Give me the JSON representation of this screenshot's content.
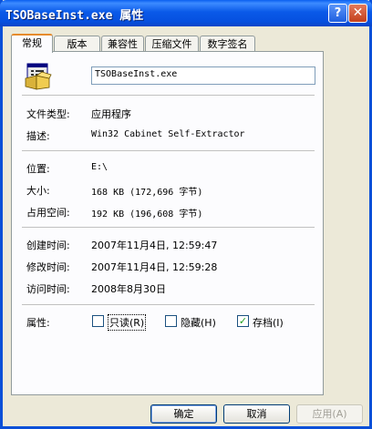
{
  "window": {
    "title": "TSOBaseInst.exe 属性",
    "help_glyph": "?",
    "close_glyph": "✕"
  },
  "tabs": [
    {
      "label": "常规",
      "active": true
    },
    {
      "label": "版本",
      "active": false
    },
    {
      "label": "兼容性",
      "active": false
    },
    {
      "label": "压缩文件",
      "active": false
    },
    {
      "label": "数字签名",
      "active": false
    }
  ],
  "general": {
    "file_name": "TSOBaseInst.exe",
    "icon": "installer-package-icon",
    "fields": {
      "type": {
        "label": "文件类型:",
        "value": "应用程序"
      },
      "description": {
        "label": "描述:",
        "value": "Win32 Cabinet Self-Extractor"
      },
      "location": {
        "label": "位置:",
        "value": "E:\\"
      },
      "size": {
        "label": "大小:",
        "value": "168 KB (172,696 字节)"
      },
      "size_on_disk": {
        "label": "占用空间:",
        "value": "192 KB (196,608 字节)"
      },
      "created": {
        "label": "创建时间:",
        "value": "2007年11月4日, 12:59:47"
      },
      "modified": {
        "label": "修改时间:",
        "value": "2007年11月4日, 12:59:28"
      },
      "accessed": {
        "label": "访问时间:",
        "value": "2008年8月30日"
      }
    },
    "attributes": {
      "label": "属性:",
      "read_only": {
        "label": "只读(R)",
        "checked": false
      },
      "hidden": {
        "label": "隐藏(H)",
        "checked": false
      },
      "archive": {
        "label": "存档(I)",
        "checked": true
      }
    }
  },
  "buttons": {
    "ok": "确定",
    "cancel": "取消",
    "apply": "应用(A)"
  },
  "colors": {
    "titlebar": "#0A5AE8",
    "dialog_bg": "#ECE9D8",
    "active_tab_accent": "#E68B2C",
    "checkmark": "#21A121"
  }
}
